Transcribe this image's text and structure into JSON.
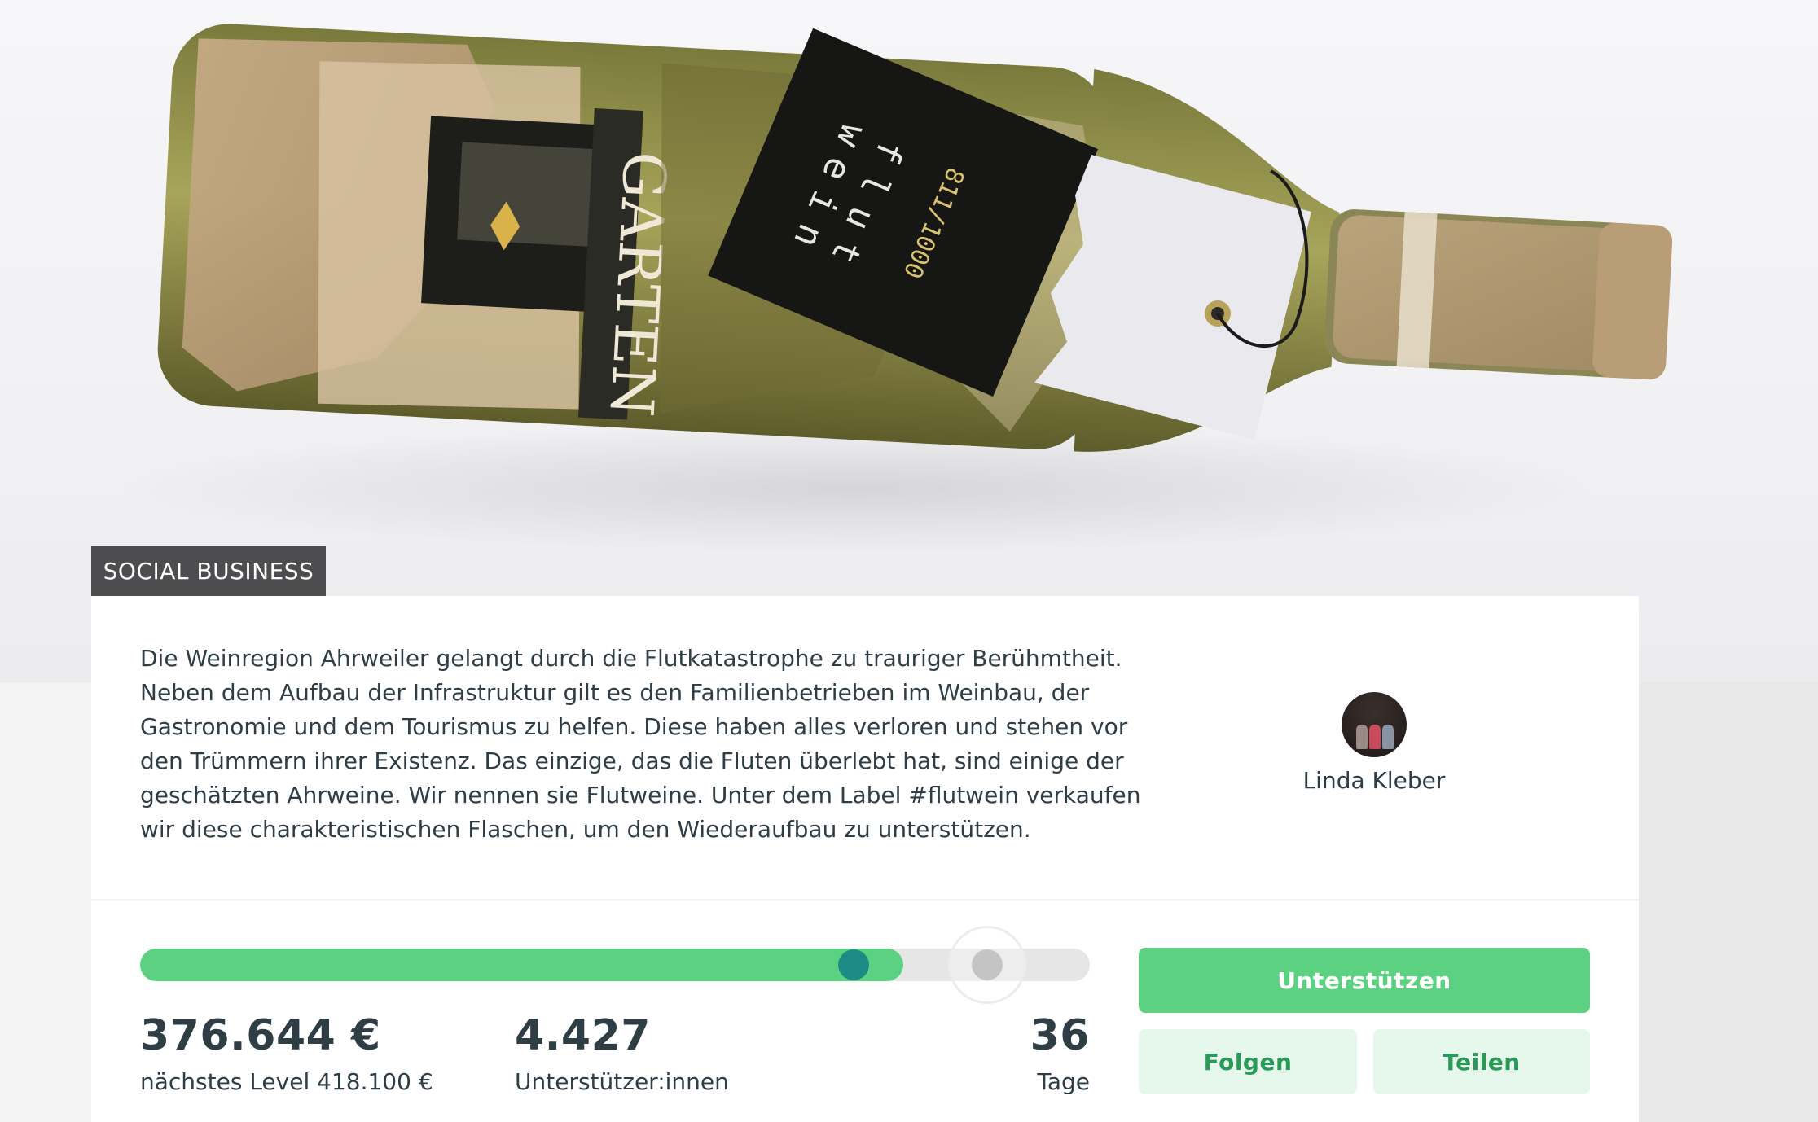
{
  "hero": {
    "image": "flutwein-bottle",
    "bottle_label_text": "GARTEN",
    "hang_tag_lines": [
      "flut",
      "wein"
    ],
    "hang_tag_number": "811/1000"
  },
  "category_tag": "SOCIAL BUSINESS",
  "description": "Die Weinregion Ahrweiler gelangt durch die Flutkatastrophe zu trauriger Berühmtheit. Neben dem Aufbau der Infrastruktur gilt es den Familienbetrieben im Weinbau, der Gastronomie und dem Tourismus zu helfen. Diese haben alles verloren und stehen vor den Trümmern ihrer Existenz. Das einzige, das die Fluten überlebt hat, sind einige der geschätzten Ahrweine. Wir nennen sie Flutweine. Unter dem Label #flutwein verkaufen wir diese charakteristischen Flaschen, um den Wiederaufbau zu unterstützen.",
  "author": {
    "name": "Linda Kleber"
  },
  "progress": {
    "fraction": 0.901,
    "next_level_fraction": 1.0
  },
  "stats": {
    "amount": "376.644 €",
    "next_level_label": "nächstes Level 418.100 €",
    "supporters": "4.427",
    "supporters_label": "Unterstützer:innen",
    "days": "36",
    "days_label": "Tage"
  },
  "buttons": {
    "support": "Unterstützen",
    "follow": "Folgen",
    "share": "Teilen"
  },
  "colors": {
    "accent_green": "#5bd181",
    "light_green": "#e6f7ec",
    "progress_dot": "#1e8a85",
    "tag_bg": "#4d4d4f",
    "text": "#2f3d45"
  }
}
